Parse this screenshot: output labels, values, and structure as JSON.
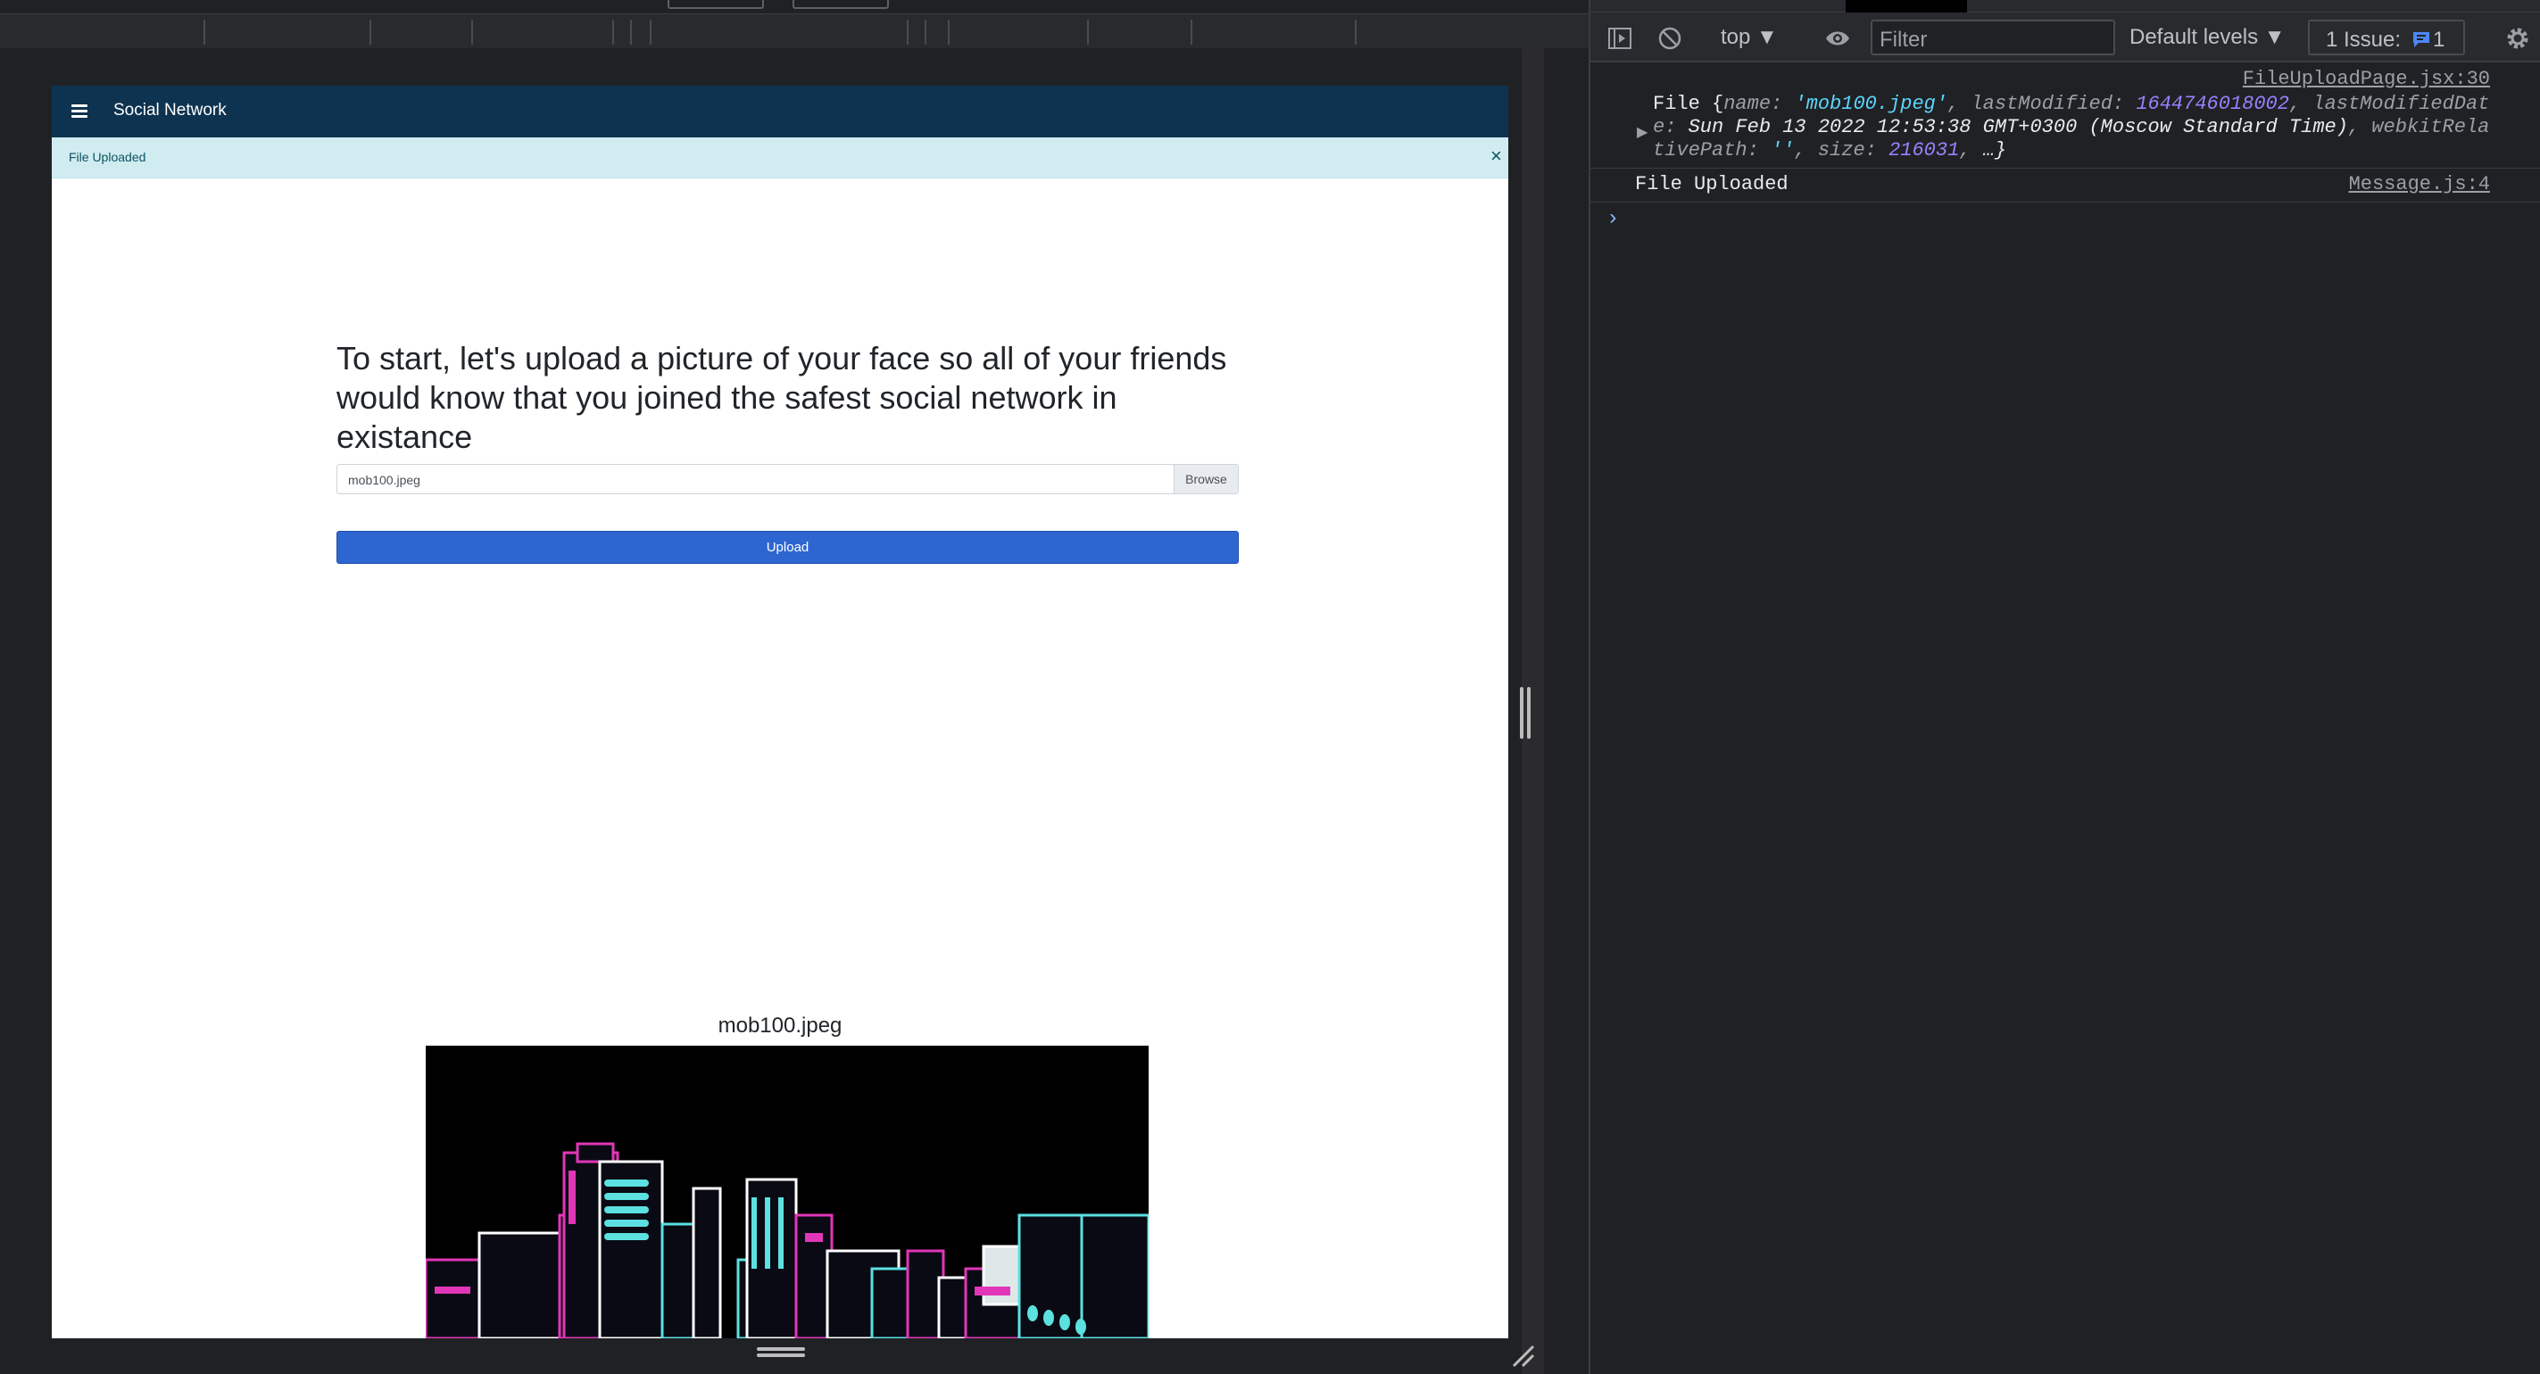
{
  "page": {
    "app_title": "Social Network",
    "alert_text": "File Uploaded",
    "alert_close": "×",
    "heading": "To start, let's upload a picture of your face so all of your friends would know that you joined the safest social network in existance",
    "file_value": "mob100.jpeg",
    "browse_label": "Browse",
    "upload_label": "Upload",
    "image_caption": "mob100.jpeg"
  },
  "devtools": {
    "context": "top ▼",
    "filter_placeholder": "Filter",
    "levels": "Default levels ▼",
    "issues_label": "1 Issue:",
    "issues_count": "1",
    "logs": [
      {
        "source": "FileUploadPage.jsx:30",
        "prefix": "File {",
        "name_key": "name",
        "name_val": "'mob100.jpeg'",
        "lm_key": "lastModified",
        "lm_val": "1644746018002",
        "lmd_key": "lastModifiedDate",
        "lmd_val": "Sun Feb 13 2022 12:53:38 GMT+0300 (Moscow Standard Time)",
        "wrp_key": "webkitRelativePath",
        "wrp_val": "''",
        "size_key": "size",
        "size_val": "216031",
        "suffix": "…}"
      },
      {
        "source": "Message.js:4",
        "text": "File Uploaded"
      }
    ],
    "prompt": "›"
  },
  "colors": {
    "app_bar": "#0e3350",
    "alert_bg": "#d1ecf1",
    "upload_button": "#2e66d1",
    "console_string": "#5cd5fb",
    "console_number": "#9980ff"
  }
}
